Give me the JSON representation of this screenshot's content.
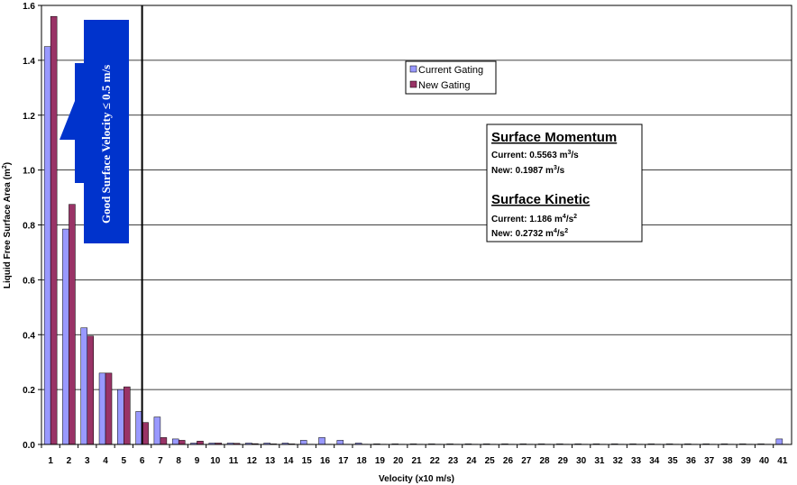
{
  "chart_data": {
    "type": "bar",
    "xlabel": "Velocity (x10 m/s)",
    "ylabel": "Liquid Free Surface Area (m",
    "ylabel_sup": "2",
    "ylabel_close": ")",
    "ylim": [
      0,
      1.6
    ],
    "yticks": [
      "0.0",
      "0.2",
      "0.4",
      "0.6",
      "0.8",
      "1.0",
      "1.2",
      "1.4",
      "1.6"
    ],
    "categories": [
      "1",
      "2",
      "3",
      "4",
      "5",
      "6",
      "7",
      "8",
      "9",
      "10",
      "11",
      "12",
      "13",
      "14",
      "15",
      "16",
      "17",
      "18",
      "19",
      "20",
      "21",
      "22",
      "23",
      "24",
      "25",
      "26",
      "27",
      "28",
      "29",
      "30",
      "31",
      "32",
      "33",
      "34",
      "35",
      "36",
      "37",
      "38",
      "39",
      "40",
      "41"
    ],
    "series": [
      {
        "name": "Current Gating",
        "color": "#9999ff",
        "values": [
          1.45,
          0.785,
          0.425,
          0.26,
          0.2,
          0.12,
          0.1,
          0.02,
          0.005,
          0.005,
          0.005,
          0.005,
          0.005,
          0.005,
          0.015,
          0.025,
          0.015,
          0.005,
          0.002,
          0.002,
          0.002,
          0.002,
          0.002,
          0.002,
          0.002,
          0.002,
          0.002,
          0.002,
          0.002,
          0.002,
          0.002,
          0.002,
          0.002,
          0.002,
          0.002,
          0.002,
          0.002,
          0.002,
          0.002,
          0.002,
          0.02
        ]
      },
      {
        "name": "New Gating",
        "color": "#993366",
        "values": [
          1.56,
          0.875,
          0.395,
          0.26,
          0.21,
          0.08,
          0.025,
          0.015,
          0.012,
          0.005,
          0.004,
          0.003,
          0.002,
          0.002,
          0.001,
          0.001,
          0.001,
          0.001,
          0.001,
          0.001,
          0.001,
          0.001,
          0.001,
          0.001,
          0.001,
          0.001,
          0.001,
          0.001,
          0.001,
          0.001,
          0.001,
          0.001,
          0.001,
          0.001,
          0.001,
          0.001,
          0.001,
          0.001,
          0.001,
          0.001,
          0.001
        ]
      }
    ],
    "threshold_x": 5.5,
    "grid": true,
    "legend": "top-center"
  },
  "annotation": {
    "arrow_text": "Good Surface Velocity ",
    "arrow_sym": "≤",
    "arrow_value": " 0.5 m/s",
    "arrow_color": "#0033cc"
  },
  "infobox": {
    "momentum_title": "Surface Momentum",
    "momentum_current_label": "Current:  0.5563 m",
    "momentum_current_sup": "3",
    "momentum_current_unit": "/s",
    "momentum_new_label": "New:  0.1987 m",
    "momentum_new_sup": "3",
    "momentum_new_unit": "/s",
    "kinetic_title": "Surface Kinetic",
    "kinetic_current_label": "Current:  1.186 m",
    "kinetic_current_sup1": "4",
    "kinetic_current_mid": "/s",
    "kinetic_current_sup2": "2",
    "kinetic_new_label": "New:    0.2732 m",
    "kinetic_new_sup1": "4",
    "kinetic_new_mid": "/s",
    "kinetic_new_sup2": "2"
  }
}
